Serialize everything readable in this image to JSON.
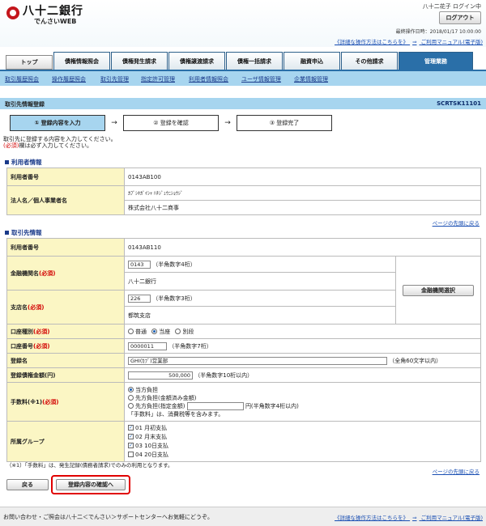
{
  "header": {
    "logo_text": "八十二銀行",
    "logo_sub": "でんさいWEB",
    "user": "八十二花子 ログイン中",
    "logout": "ログアウト",
    "last_op": "最終操作日時：2018/01/17 10:00:00",
    "link_detail": "《詳細な操作方法はこちらを》",
    "arrow": "⇒",
    "link_manual": "ご利用マニュアル(電子版)"
  },
  "tabs": {
    "top": "トップ",
    "items": [
      "債権情報照会",
      "債権発生請求",
      "債権譲渡請求",
      "債権一括請求",
      "融資申込",
      "その他請求",
      "管理業務"
    ]
  },
  "subnav": [
    "取引履歴照会",
    "操作履歴照会",
    "取引先管理",
    "指定許可管理",
    "利用者情報照会",
    "ユーザ情報管理",
    "企業情報管理"
  ],
  "page": {
    "title": "取引先情報登録",
    "code": "SCRTSK11101"
  },
  "steps": [
    "① 登録内容を入力",
    "② 登録を確認",
    "③ 登録完了"
  ],
  "step_arrow": "→",
  "instructions": {
    "line1": "取引先に登録する内容を入力してください。",
    "req_mark": "(必須)",
    "line2": "欄は必ず入力してください。"
  },
  "user_info": {
    "title": "利用者情報",
    "user_no_label": "利用者番号",
    "user_no": "0143AB100",
    "name_label": "法人名／個人事業者名",
    "name_kana": "ｶﾌﾞｼｷｶﾞｲｼｬ ﾊﾁｼﾞｭｳﾆｼｮｳｼﾞ",
    "name": "株式会社八十二商事"
  },
  "go_top": "ページの先頭に戻る",
  "partner": {
    "title": "取引先情報",
    "user_no_label": "利用者番号",
    "user_no": "0143AB110",
    "bank_label": "金融機関名",
    "bank_code": "0143",
    "bank_code_hint": "（半角数字4桁）",
    "bank_name": "八十二銀行",
    "bank_select": "金融機関選択",
    "branch_label": "支店名",
    "branch_code": "226",
    "branch_code_hint": "（半角数字3桁）",
    "branch_name": "都筑支店",
    "acct_type_label": "口座種別",
    "acct_types": [
      "普通",
      "当座",
      "別段"
    ],
    "acct_no_label": "口座番号",
    "acct_no": "0000011",
    "acct_no_hint": "（半角数字7桁）",
    "reg_name_label": "登録名",
    "reg_name": "GHI(ｶﾌﾞ)営業部",
    "reg_name_hint": "（全角60文字以内）",
    "amount_label": "登録債権金額(円)",
    "amount": "500,000",
    "amount_hint": "（半角数字10桁以内）",
    "fee_label": "手数料(※1)",
    "fee_options": [
      "当方負担",
      "先方負担(金額済み金額)",
      "先方負担(指定金額)"
    ],
    "fee_yen": "円(半角数字4桁以内)",
    "fee_note": "「手数料」は、消費税等を含みます。",
    "group_label": "所属グループ",
    "groups": [
      "01 月初支払",
      "02 月末支払",
      "03 10日支払",
      "04 20日支払"
    ],
    "required": "(必須)",
    "note": "（※1）「手数料」は、発生記録(債務者請求)でのみの利用となります。"
  },
  "buttons": {
    "back": "戻る",
    "confirm": "登録内容の確認へ"
  },
  "footer": {
    "text": "お問い合わせ・ご照会は八十二＜でんさい＞サポートセンターへお気軽にどうぞ。"
  },
  "colors": {
    "accent": "#2a6fa8",
    "subnav_bg": "#a7d5ef",
    "label_bg": "#fbf6c4",
    "required": "#d20000",
    "highlight": "#e00000"
  }
}
